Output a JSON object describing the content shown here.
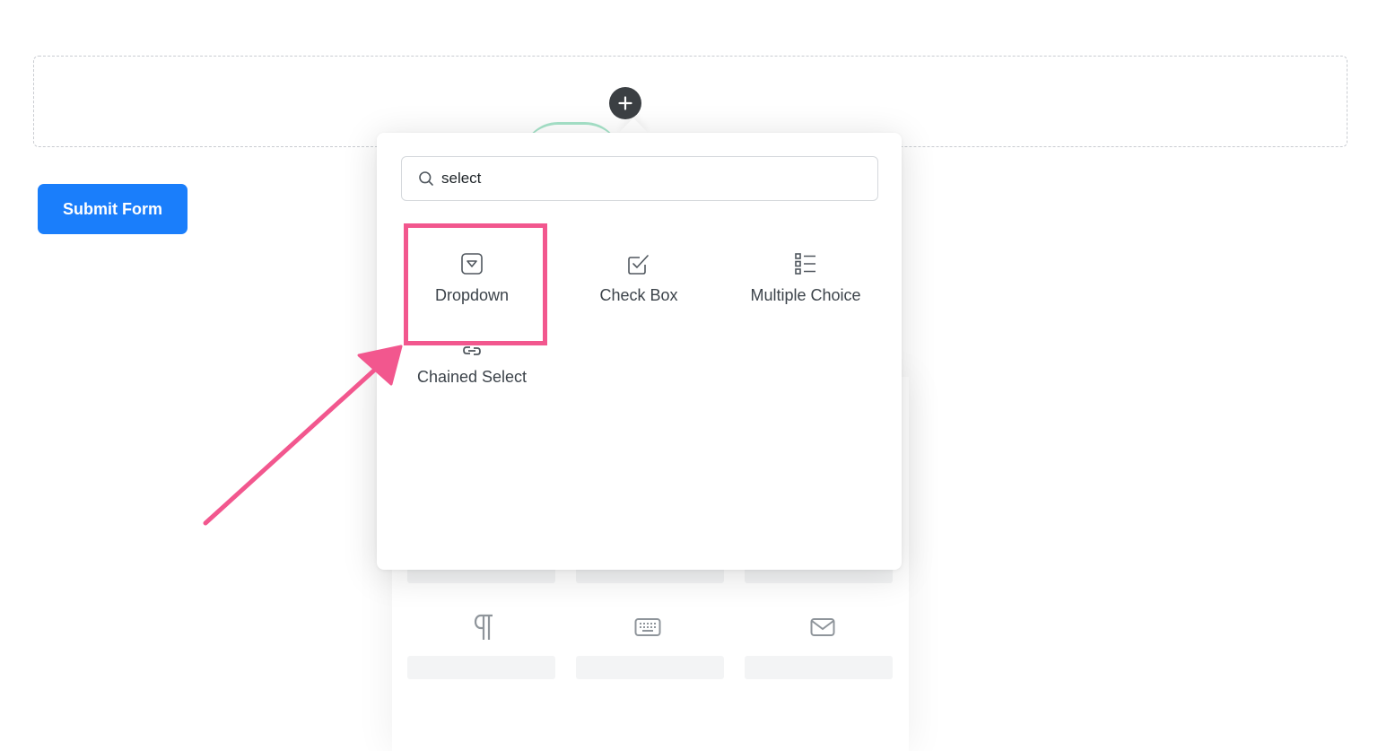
{
  "form": {
    "submit_label": "Submit Form"
  },
  "popover": {
    "search": {
      "value": "select",
      "placeholder": ""
    },
    "items": [
      {
        "label": "Dropdown",
        "icon": "dropdown-icon"
      },
      {
        "label": "Check Box",
        "icon": "checkbox-icon"
      },
      {
        "label": "Multiple Choice",
        "icon": "list-icon"
      },
      {
        "label": "Chained Select",
        "icon": "link-icon"
      }
    ]
  },
  "background_panel": {
    "icons": [
      "paragraph-icon",
      "keyboard-icon",
      "mail-icon"
    ]
  },
  "colors": {
    "primary": "#1a7efb",
    "annotation": "#f2578e",
    "plus_button": "#3b3f43"
  }
}
